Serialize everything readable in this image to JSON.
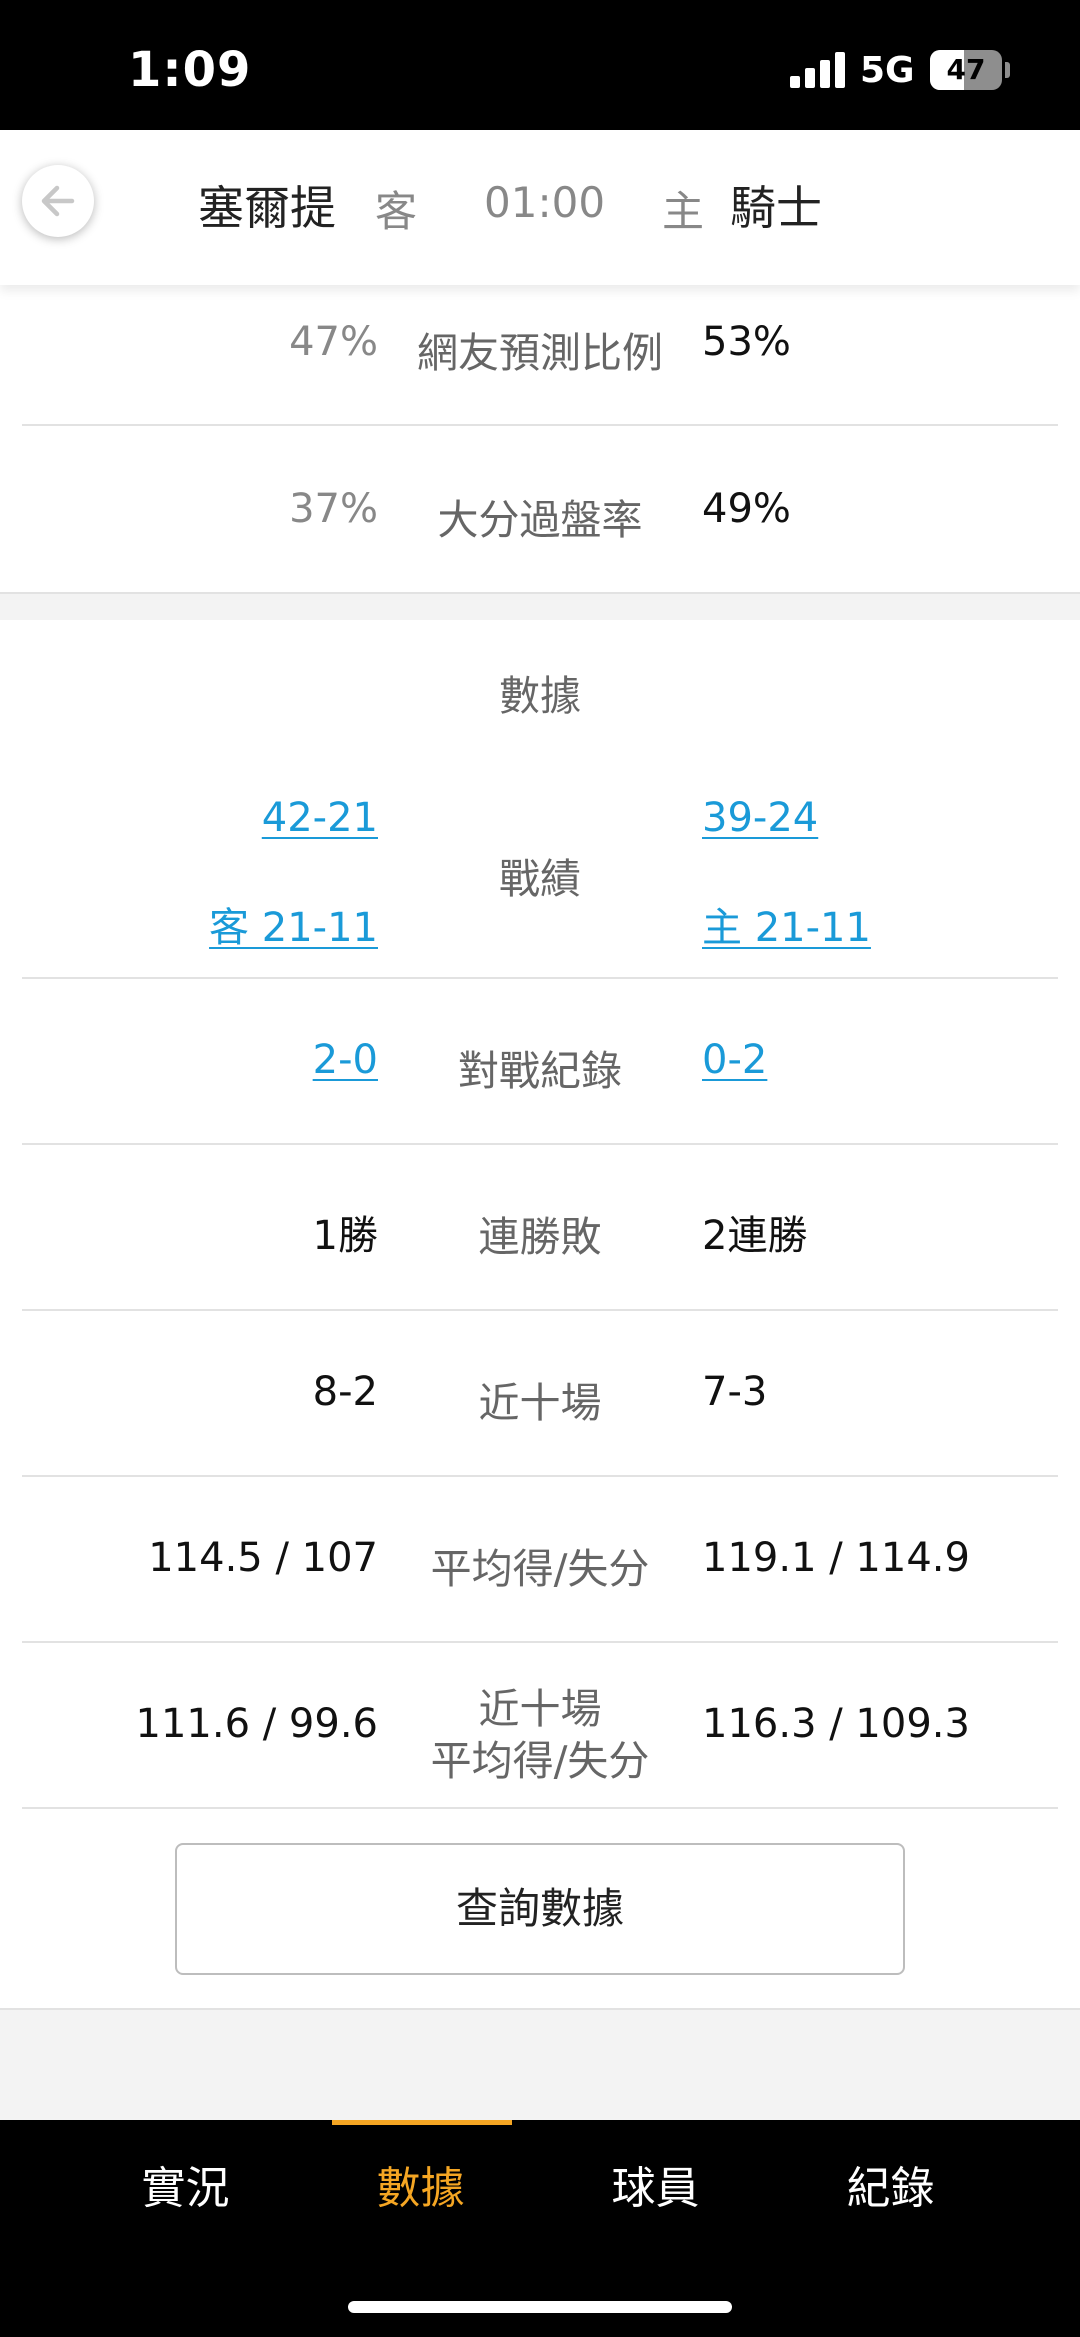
{
  "status_bar": {
    "time": "1:09",
    "network": "5G",
    "battery": "47",
    "battery_level_pct": 47
  },
  "header": {
    "away_team": "塞爾提",
    "away_tag": "客",
    "game_time": "01:00",
    "home_tag": "主",
    "home_team": "騎士"
  },
  "predictions": [
    {
      "away": "47%",
      "label": "網友預測比例",
      "home": "53%"
    },
    {
      "away": "37%",
      "label": "大分過盤率",
      "home": "49%"
    }
  ],
  "stats": {
    "title": "數據",
    "record": {
      "label": "戰績",
      "away_total": "42-21",
      "away_split": "客 21-11",
      "home_total": "39-24",
      "home_split": "主 21-11"
    },
    "h2h": {
      "label": "對戰紀錄",
      "away": "2-0",
      "home": "0-2"
    },
    "streak": {
      "label": "連勝敗",
      "away": "1勝",
      "home": "2連勝"
    },
    "last10": {
      "label": "近十場",
      "away": "8-2",
      "home": "7-3"
    },
    "avg": {
      "label": "平均得/失分",
      "away": "114.5 / 107",
      "home": "119.1 / 114.9"
    },
    "last10_avg": {
      "label_line1": "近十場",
      "label_line2": "平均得/失分",
      "away": "111.6 / 99.6",
      "home": "116.3 / 109.3"
    },
    "query_button": "查詢數據"
  },
  "tabs": [
    {
      "label": "實況",
      "active": false
    },
    {
      "label": "數據",
      "active": true
    },
    {
      "label": "球員",
      "active": false
    },
    {
      "label": "紀錄",
      "active": false
    }
  ],
  "colors": {
    "accent": "#f5a623",
    "link": "#1a9ad8"
  }
}
